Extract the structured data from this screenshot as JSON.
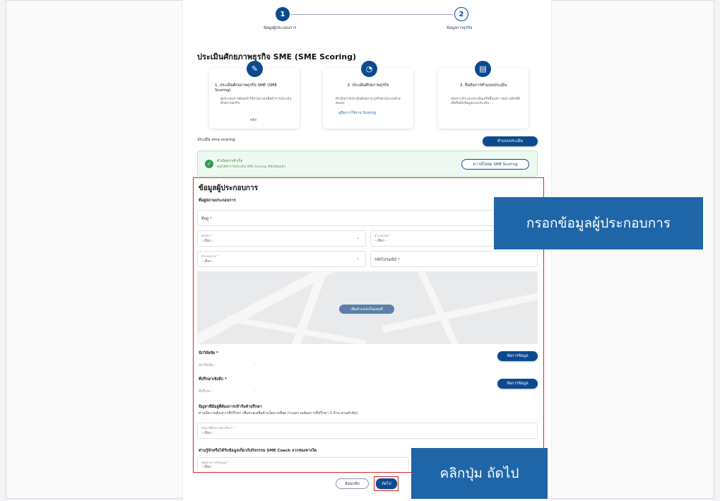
{
  "stepper": {
    "step1_number": "1",
    "step1_label": "ข้อมูลผู้ประกอบการ",
    "step2_number": "2",
    "step2_label": "ข้อมูลการธุรกิจ"
  },
  "page_title": "ประเมินศักยภาพธุรกิจ SME (SME Scoring)",
  "cards": [
    {
      "title": "1. ประเมินศักยภาพธุรกิจ SME (SME Scoring)",
      "desc": "ผู้ประกอบการต้องเข้าใช้งานระบบเพื่อทำการประเมินศักยภาพธุรกิจ",
      "link": "คลิก"
    },
    {
      "title": "2. ประเมินศักยภาพธุรกิจ",
      "desc": "ดำเนินการประเมินศักยภาพ ธุรกิจผ่านระบบด้วยตนเอง",
      "link": "คู่มือการใช้งาน Scoring"
    },
    {
      "title": "3. ยืนยันการทำแบบประเมิน",
      "desc": "หลังจากทำแบบประเมินเสร็จสิ้นแล้ว กรุณา คลิกที่นี่ เพื่อยืนยันข้อมูลแบบประเมิน",
      "link": ""
    }
  ],
  "scoring_label": "ประเมิน sme scoring",
  "do_assessment_button": "ทำแบบประเมิน",
  "success": {
    "title": "ดำเนินการสำเร็จ",
    "subtitle": "คุณได้ทำการประเมิน SME Scoring เรียบร้อยแล้ว",
    "download_button": "ดาวน์โหลด SME Scoring"
  },
  "form": {
    "heading": "ข้อมูลผู้ประกอบการ",
    "address_section": "ที่อยู่สถานประกอบการ",
    "address_placeholder": "ที่อยู่ *",
    "province_label": "จังหวัด *",
    "province_value": "- เลือก -",
    "district_label": "อำเภอ/เขต *",
    "district_value": "- เลือก -",
    "subdistrict_label": "ตำบล/แขวง *",
    "subdistrict_value": "- เลือก -",
    "postcode_placeholder": "รหัสไปรษณีย์ *",
    "map_button": "เพิ่มตำแหน่งในแผนที่",
    "accountant_title": "นักวิจัยจัย *",
    "accountant_value_label": "นักวิจัยจัย :",
    "accountant_value": "-",
    "manage_button_1": "จัดการข้อมูล",
    "consultant_title": "ที่ปรึกษาเชิงลึก *",
    "consultant_value_label": "ที่ปรึกษา :",
    "consultant_value": "-",
    "manage_button_2": "จัดการข้อมูล",
    "problem_title": "ปัญหาที่มีอยู่ที่ต้องการเข้ารับคำปรึกษา",
    "problem_desc": "ท่านมีความต้องการที่ปรึกษา เพื่อช่วยเหลือด้านใดมากที่สุด (ระบุความต้องการที่ปรึกษา 2 ด้าน ตามลำดับ)",
    "problem_field_label": "ปัญหาที่ต้องการคำปรึกษา *",
    "problem_field_value": "- เลือก -",
    "channel_title": "ท่านรู้จักหรือได้รับข้อมูลเกี่ยวกับกิจกรรม SME Coach จากช่องทางใด",
    "channel_field_label": "ช่องทางการรับข้อมูล *",
    "channel_field_value": "- เลือก -"
  },
  "footer": {
    "back_button": "ย้อนกลับ",
    "next_button": "ถัดไป"
  },
  "callouts": {
    "fill_info": "กรอกข้อมูลผู้ประกอบการ",
    "click_next": "คลิกปุ่ม ถัดไป"
  },
  "colors": {
    "primary": "#0b4a8f",
    "callout": "#1f66a8",
    "highlight_red": "#d62828",
    "success_green": "#2e9e52"
  }
}
